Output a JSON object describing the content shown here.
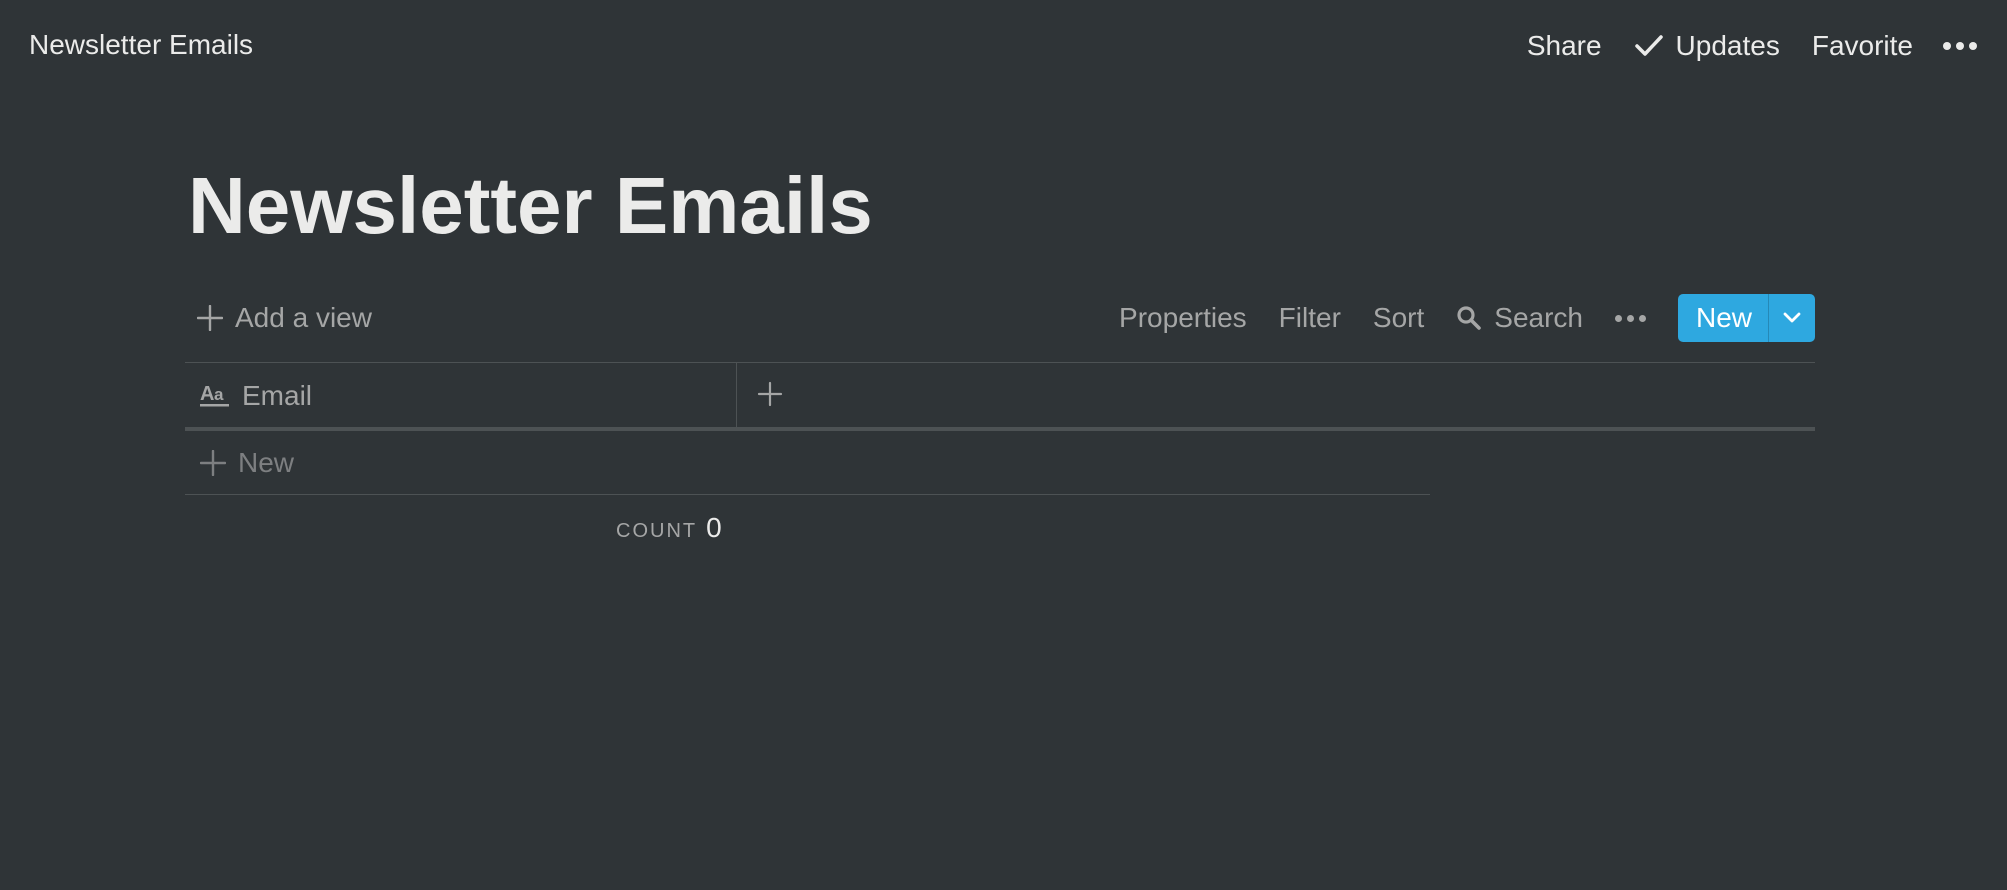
{
  "topbar": {
    "breadcrumb": "Newsletter Emails",
    "share_label": "Share",
    "updates_label": "Updates",
    "favorite_label": "Favorite",
    "more_icon": "more-horizontal-icon"
  },
  "page": {
    "title": "Newsletter Emails"
  },
  "toolbar": {
    "add_view_label": "Add a view",
    "properties_label": "Properties",
    "filter_label": "Filter",
    "sort_label": "Sort",
    "search_label": "Search",
    "new_label": "New"
  },
  "table": {
    "columns": [
      {
        "label": "Email",
        "icon": "text-property-icon"
      }
    ],
    "rows": [],
    "new_row_label": "New",
    "count_label": "COUNT",
    "count_value": "0"
  },
  "colors": {
    "background": "#2f3437",
    "accent": "#2ea8e0",
    "text": "#ebebea",
    "muted": "#a5a6a6",
    "divider": "#4d5254"
  }
}
